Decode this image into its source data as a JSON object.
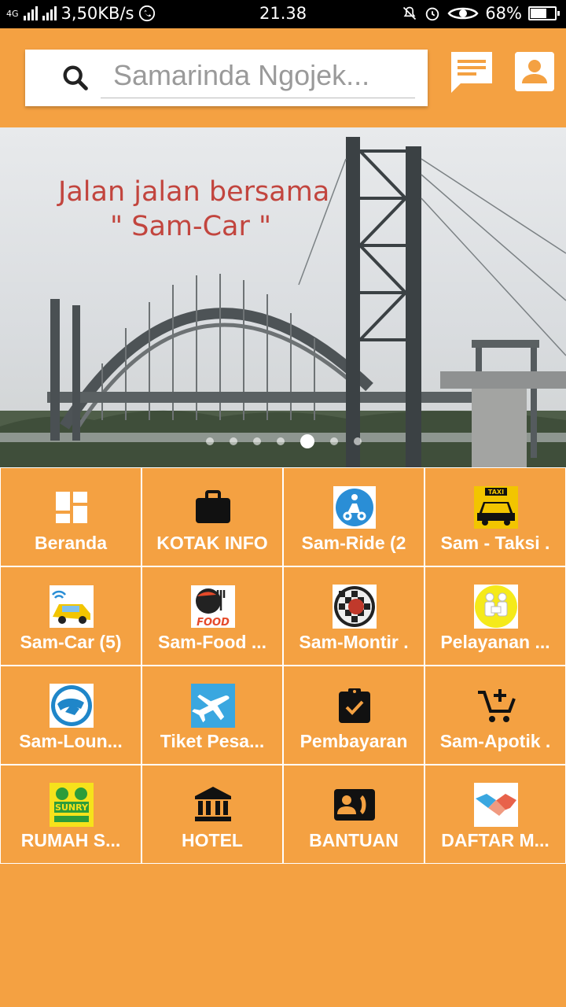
{
  "statusbar": {
    "network": "4G",
    "speed": "3,50KB/s",
    "time": "21.38",
    "battery": "68%",
    "battery_level": 0.68
  },
  "search": {
    "placeholder": "Samarinda Ngojek..."
  },
  "banner": {
    "line1": "Jalan jalan bersama",
    "line2": "\" Sam-Car \"",
    "slide_count": 7,
    "active_slide": 5
  },
  "menu": [
    {
      "label": "Beranda",
      "icon": "dashboard-icon"
    },
    {
      "label": "KOTAK INFO",
      "icon": "briefcase-icon"
    },
    {
      "label": "Sam-Ride (2",
      "icon": "scooter-icon"
    },
    {
      "label": "Sam - Taksi .",
      "icon": "taxi-icon"
    },
    {
      "label": "Sam-Car (5)",
      "icon": "car-icon"
    },
    {
      "label": "Sam-Food ...",
      "icon": "food-icon"
    },
    {
      "label": "Sam-Montir .",
      "icon": "mechanic-icon"
    },
    {
      "label": "Pelayanan ...",
      "icon": "service-icon"
    },
    {
      "label": "Sam-Loun...",
      "icon": "lounge-icon"
    },
    {
      "label": "Tiket Pesa...",
      "icon": "airplane-icon"
    },
    {
      "label": "Pembayaran",
      "icon": "clipboard-check-icon"
    },
    {
      "label": "Sam-Apotik .",
      "icon": "cart-add-icon"
    },
    {
      "label": "RUMAH S...",
      "icon": "school-icon"
    },
    {
      "label": "HOTEL",
      "icon": "bank-icon"
    },
    {
      "label": "BANTUAN",
      "icon": "contact-phone-icon"
    },
    {
      "label": "DAFTAR M...",
      "icon": "handshake-icon"
    }
  ],
  "colors": {
    "primary": "#F4A142",
    "statusbar": "#000000",
    "banner_text": "#C2453E"
  }
}
